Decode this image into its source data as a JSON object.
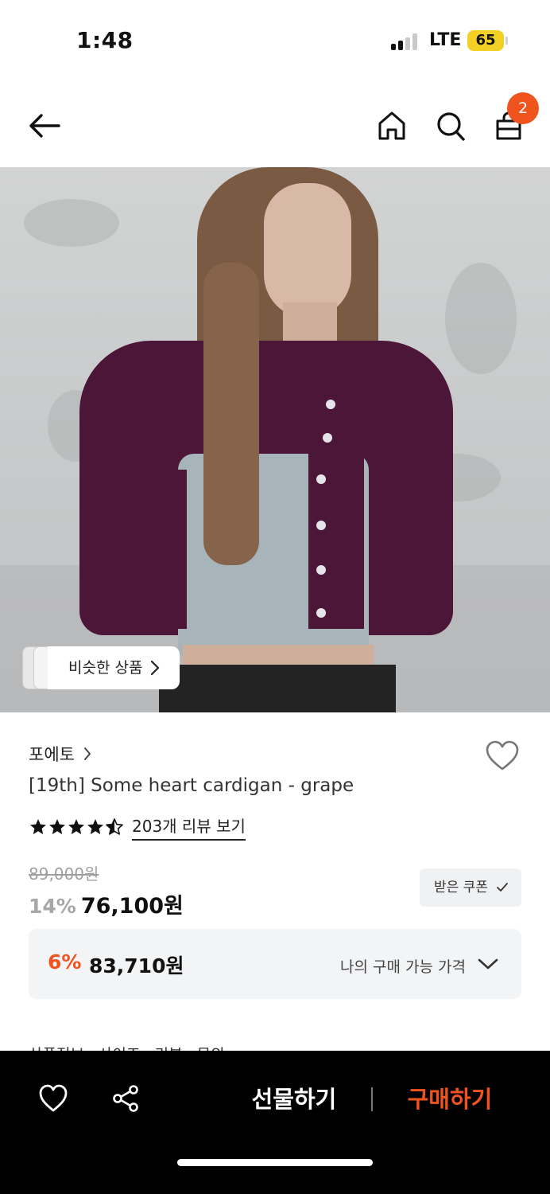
{
  "status_bar": {
    "time": "1:48",
    "network": "LTE",
    "battery": "65"
  },
  "nav": {
    "cart_count": "2",
    "icons": [
      "back-arrow-icon",
      "home-icon",
      "search-icon",
      "shopping-bag-icon"
    ]
  },
  "hero": {
    "similar_products_label": "비슷한 상품"
  },
  "product": {
    "brand": "포에토",
    "title": "[19th] Some heart cardigan - grape",
    "rating_stars": 4.5,
    "review_link": "203개 리뷰 보기",
    "original_price": "89,000원",
    "discount_rate": "14%",
    "sale_price": "76,100원",
    "coupon_button": "받은 쿠폰"
  },
  "my_price": {
    "discount_rate": "6%",
    "price": "83,710원",
    "label": "나의 구매 가능 가격"
  },
  "tabs_peek": "상품정보  ·  사이즈  ·  리뷰  ·  문의",
  "bottom_bar": {
    "gift_label": "선물하기",
    "buy_label": "구매하기"
  },
  "colors": {
    "accent": "#f0541e",
    "cardigan": "#4b1638"
  }
}
